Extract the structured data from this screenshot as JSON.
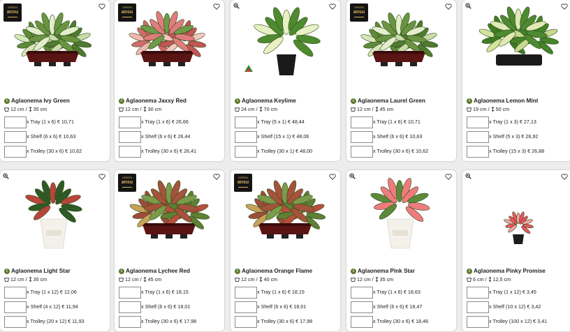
{
  "products": [
    {
      "name": "Aglaonema Ivy Green",
      "pot": "12 cm",
      "height": "35 cm",
      "badge": "logo",
      "plant": "green-tray",
      "options": [
        {
          "label": "x Tray (1 x 6) € 10,71"
        },
        {
          "label": "x Shelf (6 x 6) € 10,63"
        },
        {
          "label": "x Trolley (30 x 6) € 10,62"
        }
      ]
    },
    {
      "name": "Aglaonema Jaxxy Red",
      "pot": "12 cm",
      "height": "30 cm",
      "badge": "logo",
      "plant": "pink-tray",
      "options": [
        {
          "label": "x Tray (1 x 6) € 26,66"
        },
        {
          "label": "x Shelf (6 x 6) € 26,44"
        },
        {
          "label": "x Trolley (30 x 6) € 26,41"
        }
      ]
    },
    {
      "name": "Aglaonema Keylime",
      "pot": "24 cm",
      "height": "70 cm",
      "badge": "zoom",
      "plant": "single-green",
      "options": [
        {
          "label": "x Tray (5 x 1) € 48,44"
        },
        {
          "label": "x Shelf (15 x 1) € 48,06"
        },
        {
          "label": "x Trolley (30 x 1) € 48,00"
        }
      ]
    },
    {
      "name": "Aglaonema Laurel Green",
      "pot": "12 cm",
      "height": "45 cm",
      "badge": "logo",
      "plant": "green-tray",
      "options": [
        {
          "label": "x Tray (1 x 6) € 10,71"
        },
        {
          "label": "x Shelf (6 x 6) € 10,63"
        },
        {
          "label": "x Trolley (30 x 6) € 10,62"
        }
      ]
    },
    {
      "name": "Aglaonema Lemon Mint",
      "pot": "19 cm",
      "height": "50 cm",
      "badge": "zoom",
      "plant": "multi-green",
      "options": [
        {
          "label": "x Tray (1 x 3) € 27,13"
        },
        {
          "label": "x Shelf (5 x 3) € 26,92"
        },
        {
          "label": "x Trolley (15 x 3) € 26,88"
        }
      ]
    },
    {
      "name": "Aglaonema Light Star",
      "pot": "12 cm",
      "height": "35 cm",
      "badge": "zoom",
      "plant": "paper-red",
      "options": [
        {
          "label": "x Tray (1 x 12) € 12,06"
        },
        {
          "label": "x Shelf (4 x 12) € 11,94"
        },
        {
          "label": "x Trolley (20 x 12) € 11,93"
        }
      ]
    },
    {
      "name": "Aglaonema Lychee Red",
      "pot": "12 cm",
      "height": "45 cm",
      "badge": "logo",
      "plant": "red-tray",
      "options": [
        {
          "label": "x Tray (1 x 6) € 18,15"
        },
        {
          "label": "x Shelf (6 x 6) € 18,01"
        },
        {
          "label": "x Trolley (30 x 6) € 17,98"
        }
      ]
    },
    {
      "name": "Aglaonema Orange Flame",
      "pot": "12 cm",
      "height": "40 cm",
      "badge": "logo",
      "plant": "red-tray",
      "options": [
        {
          "label": "x Tray (1 x 6) € 18,15"
        },
        {
          "label": "x Shelf (6 x 6) € 18,01"
        },
        {
          "label": "x Trolley (30 x 6) € 17,98"
        }
      ]
    },
    {
      "name": "Aglaonema Pink Star",
      "pot": "12 cm",
      "height": "35 cm",
      "badge": "zoom",
      "plant": "paper-pink",
      "options": [
        {
          "label": "x Tray (1 x 6) € 18,63"
        },
        {
          "label": "x Shelf (6 x 6) € 18,47"
        },
        {
          "label": "x Trolley (30 x 6) € 18,46"
        }
      ]
    },
    {
      "name": "Aglaonema Pinky Promise",
      "pot": "6 cm",
      "height": "12,5 cm",
      "badge": "zoom",
      "plant": "small-pink",
      "options": [
        {
          "label": "x Tray (1 x 12) € 3,45"
        },
        {
          "label": "x Shelf (10 x 12) € 3,42"
        },
        {
          "label": "x Trolley (100 x 12) € 3,41"
        }
      ]
    }
  ],
  "logo": {
    "line1": "GREEN",
    "line2": "ansu"
  },
  "icons": {
    "favorite": "heart-icon",
    "zoom": "zoom-icon",
    "info": "info-icon",
    "pot": "pot-icon",
    "height": "height-icon"
  },
  "colors": {
    "info": "#5d7a2f",
    "logo_bg": "#141414",
    "logo_text": "#d9b35a"
  }
}
